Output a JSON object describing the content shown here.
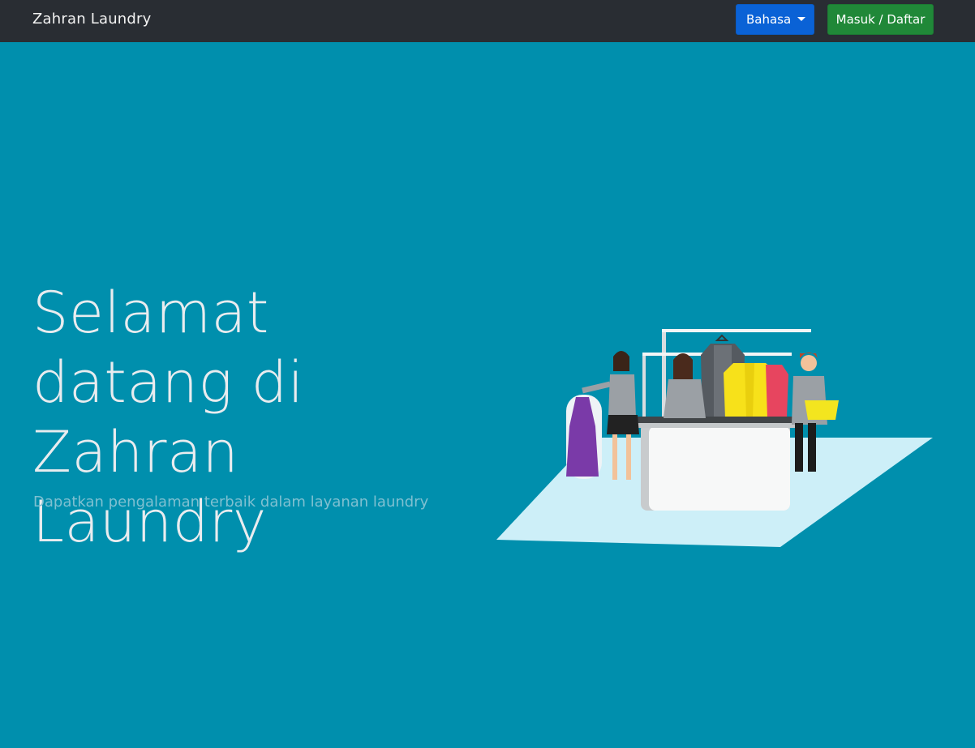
{
  "navbar": {
    "brand": "Zahran Laundry",
    "language_button": "Bahasa",
    "login_button": "Masuk / Daftar"
  },
  "hero": {
    "title": "Selamat datang di Zahran Laundry",
    "subtitle": "Dapatkan pengalaman terbaik dalam layanan laundry",
    "illustration": "laundry-shop-counter-illustration"
  },
  "colors": {
    "navbar_bg": "#292d33",
    "hero_bg": "#008fad",
    "language_button_bg": "#0a62d6",
    "login_button_bg": "#208838"
  }
}
